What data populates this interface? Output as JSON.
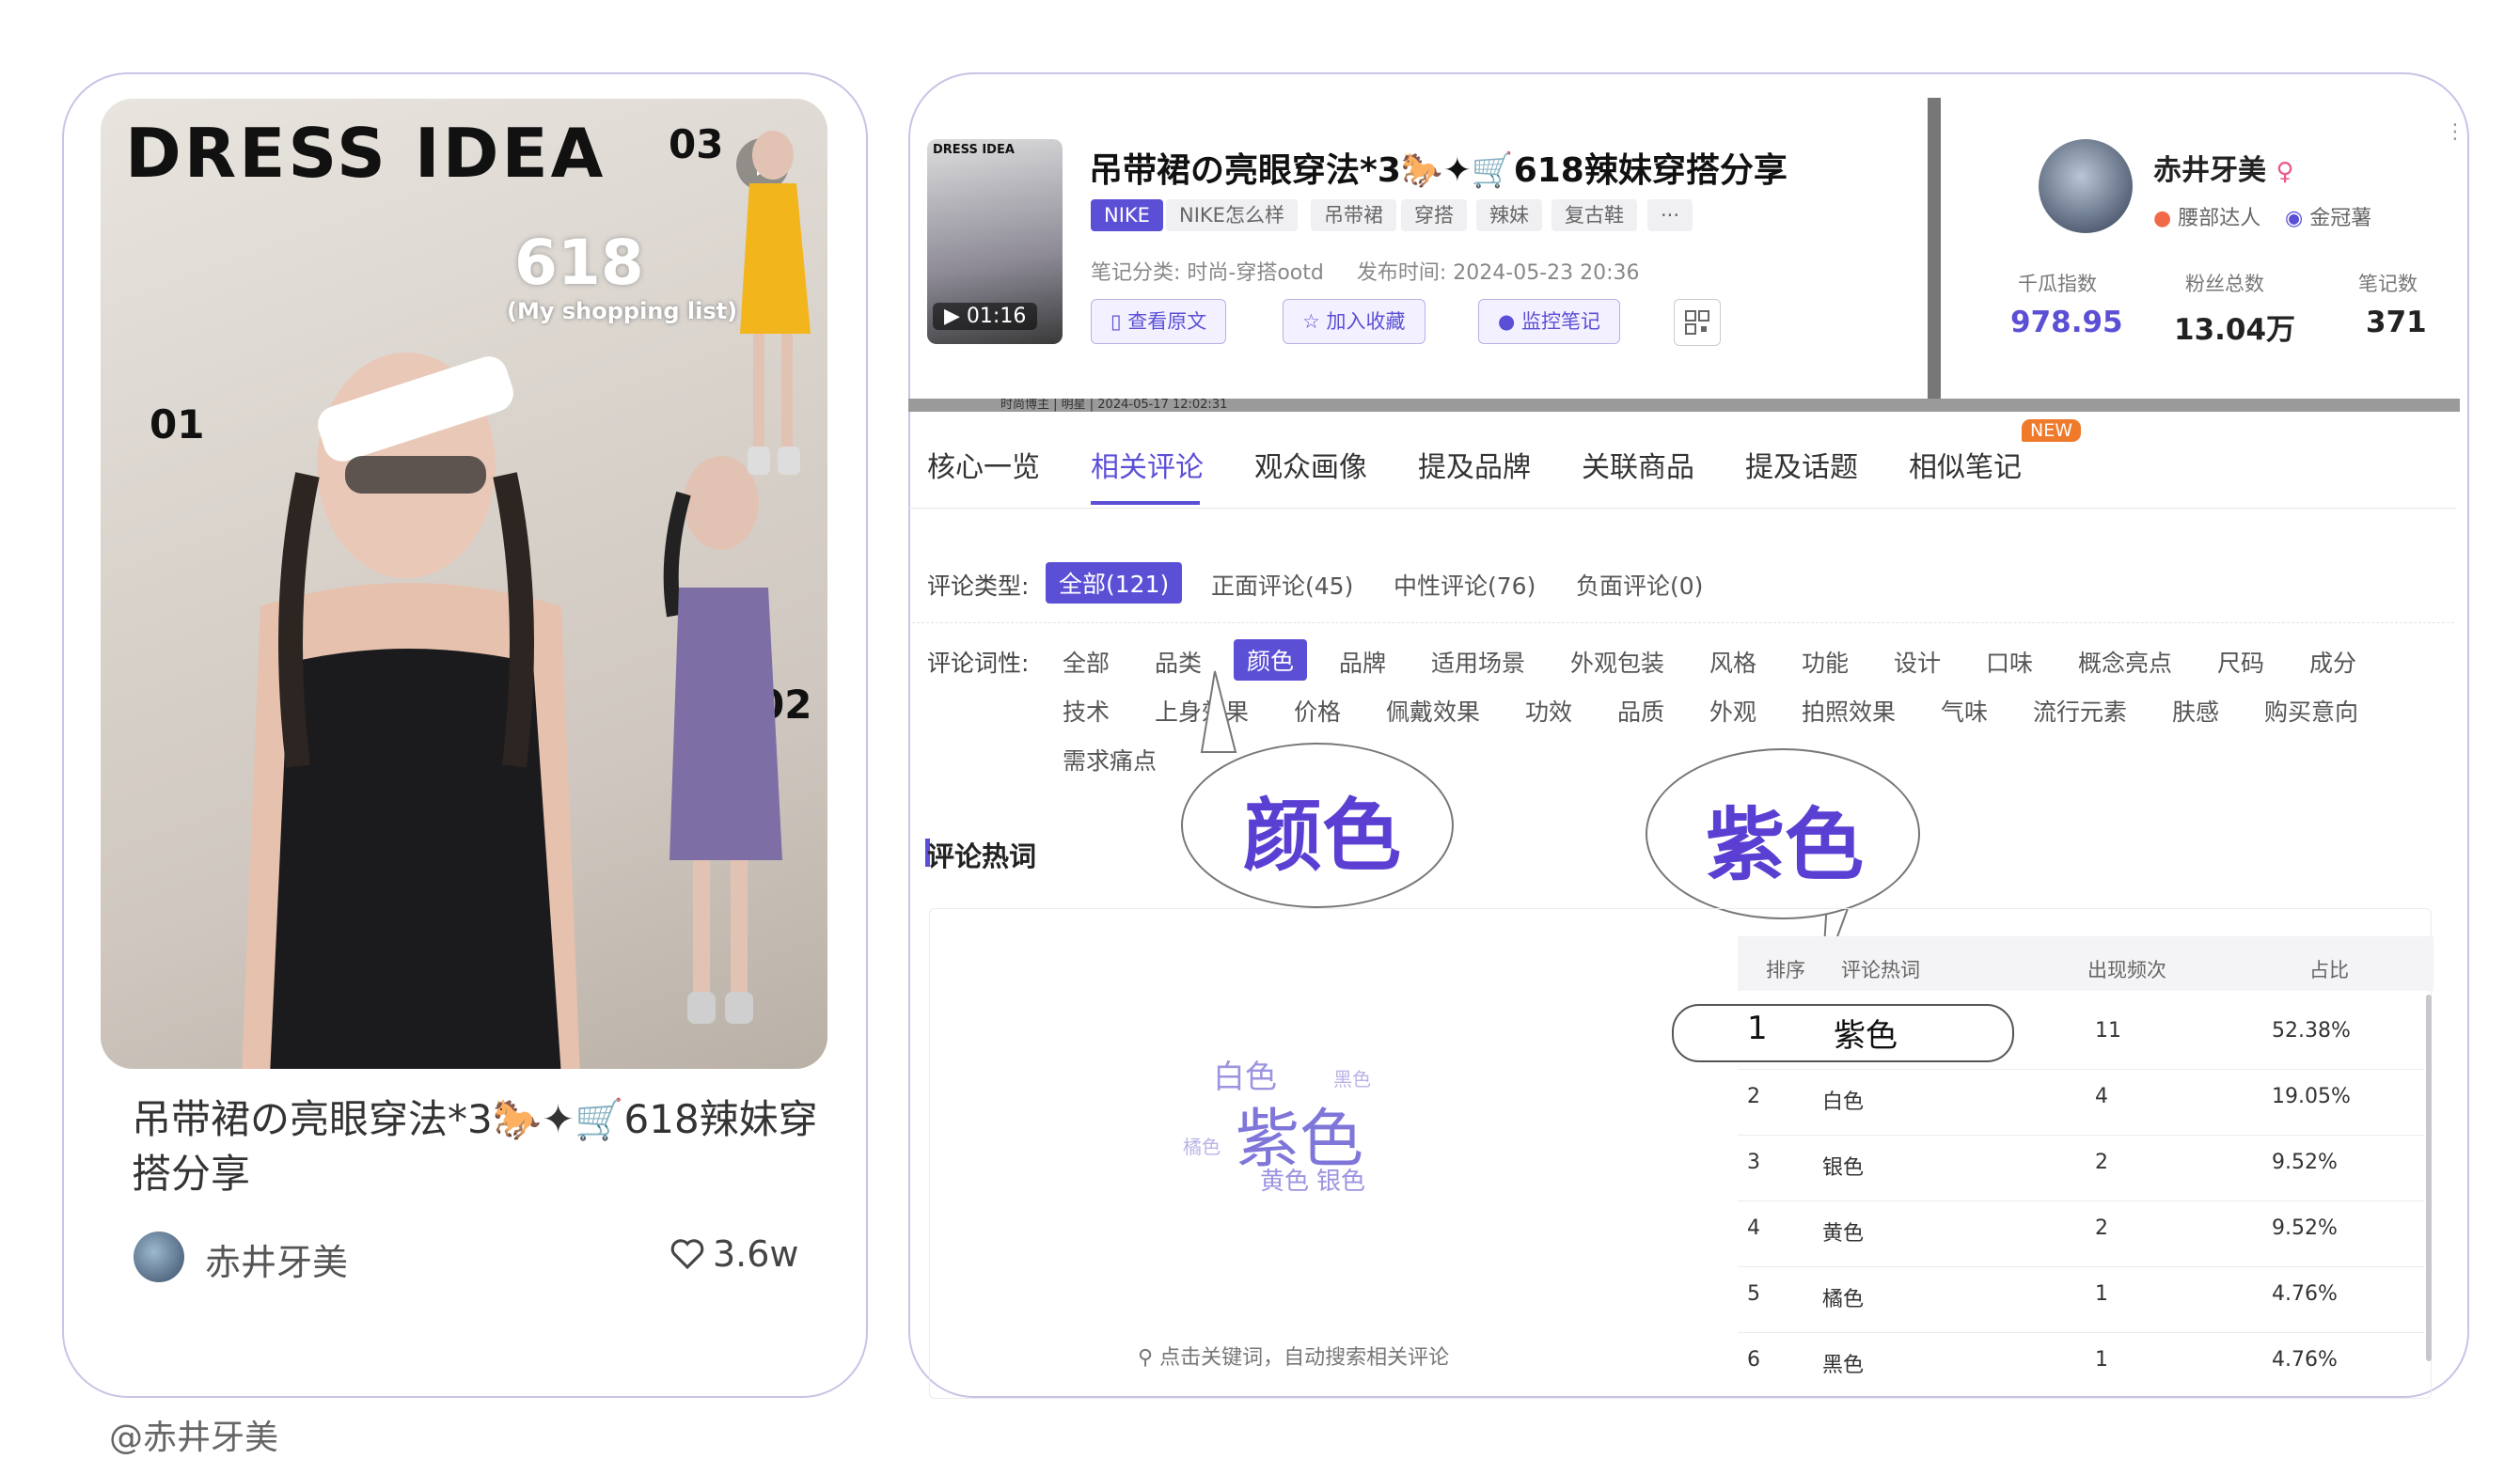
{
  "left_card": {
    "cover": {
      "title": "DRESS IDEA",
      "num_01": "01",
      "num_02": "02",
      "num_03": "03",
      "sale": "618",
      "sale_sub": "(My shopping list)"
    },
    "title": "吊带裙の亮眼穿法*3🐎✦🛒618辣妹穿搭分享",
    "author": "赤井牙美",
    "likes": "3.6w"
  },
  "watermark": "@赤井牙美",
  "note": {
    "title": "吊带裙の亮眼穿法*3🐎✦🛒618辣妹穿搭分享",
    "duration": "01:16",
    "tags": [
      "NIKE",
      "NIKE怎么样",
      "吊带裙",
      "穿搭",
      "辣妹",
      "复古鞋",
      "···"
    ],
    "category": "笔记分类: 时尚-穿搭ootd",
    "publish_time": "发布时间:  2024-05-23 20:36",
    "buttons": {
      "view_original": "查看原文",
      "add_favorite": "加入收藏",
      "monitor": "监控笔记"
    },
    "peek_text": "时尚博主 | 明星 | 2024-05-17 12:02:31"
  },
  "profile": {
    "name": "赤井牙美",
    "gender_icon": "♀",
    "badge1": "腰部达人",
    "badge2": "金冠薯",
    "stats": [
      {
        "label": "千瓜指数",
        "value": "978.95"
      },
      {
        "label": "粉丝总数",
        "value": "13.04万"
      },
      {
        "label": "笔记数",
        "value": "371"
      }
    ]
  },
  "tabs": [
    "核心一览",
    "相关评论",
    "观众画像",
    "提及品牌",
    "关联商品",
    "提及话题",
    "相似笔记"
  ],
  "new_badge": "NEW",
  "comment_type": {
    "label": "评论类型:",
    "options": [
      "全部(121)",
      "正面评论(45)",
      "中性评论(76)",
      "负面评论(0)"
    ]
  },
  "comment_attr": {
    "label": "评论词性:",
    "row1": [
      "全部",
      "品类",
      "颜色",
      "品牌",
      "适用场景",
      "外观包装",
      "风格",
      "功能",
      "设计",
      "口味",
      "概念亮点",
      "尺码",
      "成分"
    ],
    "row2": [
      "技术",
      "上身效果",
      "价格",
      "佩戴效果",
      "功效",
      "品质",
      "外观",
      "拍照效果",
      "气味",
      "流行元素",
      "肤感",
      "购买意向"
    ],
    "row3": [
      "需求痛点"
    ]
  },
  "callouts": {
    "left": "颜色",
    "right": "紫色"
  },
  "section_title": "评论热词",
  "cloud": {
    "words": [
      "白色",
      "黑色",
      "紫色",
      "橘色",
      "黄色",
      "银色"
    ],
    "hint": "点击关键词，自动搜索相关评论"
  },
  "table": {
    "headers": [
      "排序",
      "评论热词",
      "出现频次",
      "占比"
    ],
    "rows": [
      {
        "rank": "1",
        "word": "紫色",
        "count": "11",
        "ratio": "52.38%"
      },
      {
        "rank": "2",
        "word": "白色",
        "count": "4",
        "ratio": "19.05%"
      },
      {
        "rank": "3",
        "word": "银色",
        "count": "2",
        "ratio": "9.52%"
      },
      {
        "rank": "4",
        "word": "黄色",
        "count": "2",
        "ratio": "9.52%"
      },
      {
        "rank": "5",
        "word": "橘色",
        "count": "1",
        "ratio": "4.76%"
      },
      {
        "rank": "6",
        "word": "黑色",
        "count": "1",
        "ratio": "4.76%"
      }
    ]
  },
  "colors": {
    "accent": "#5b4fd6",
    "callout_text": "#5b3fd3",
    "new_badge": "#f07a2b"
  }
}
